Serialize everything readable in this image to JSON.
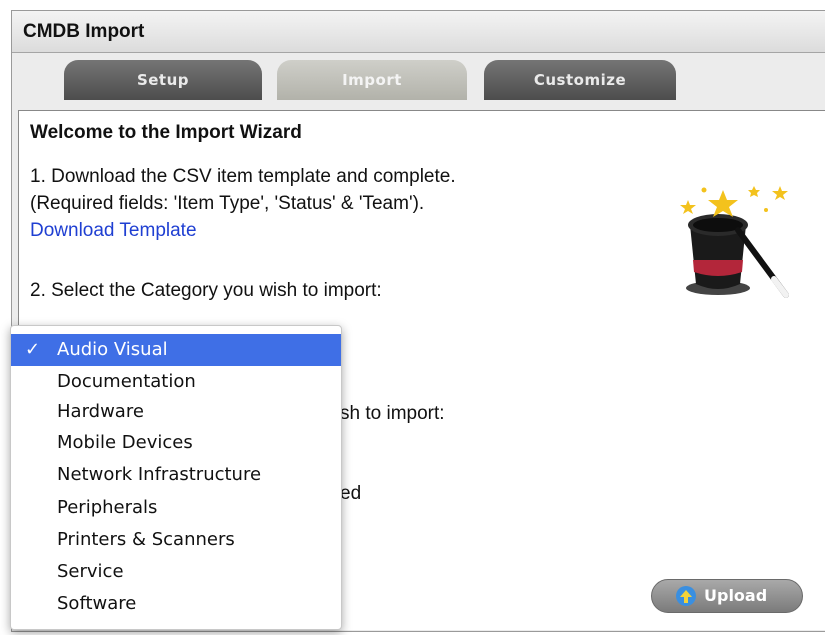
{
  "window": {
    "title": "CMDB Import"
  },
  "tabs": [
    {
      "label": "Setup"
    },
    {
      "label": "Import"
    },
    {
      "label": "Customize"
    }
  ],
  "wizard": {
    "heading": "Welcome to the Import Wizard",
    "step1_line1": "1. Download the CSV item template and complete.",
    "step1_line2": "(Required fields: 'Item Type', 'Status' & 'Team').",
    "download_link": "Download Template",
    "step2": "2. Select the Category you wish to import:",
    "step3_partial": "sh to import:",
    "step4_partial": "ed"
  },
  "category_dropdown": {
    "selected": "Audio Visual",
    "options": [
      "Audio Visual",
      "Documentation",
      "Hardware",
      "Mobile Devices",
      "Network Infrastructure",
      "Peripherals",
      "Printers & Scanners",
      "Service",
      "Software"
    ]
  },
  "upload_button": {
    "label": "Upload"
  },
  "icons": {
    "wizard_hat": "magic-hat-icon",
    "upload": "upload-arrow-icon",
    "check": "checkmark-icon"
  }
}
